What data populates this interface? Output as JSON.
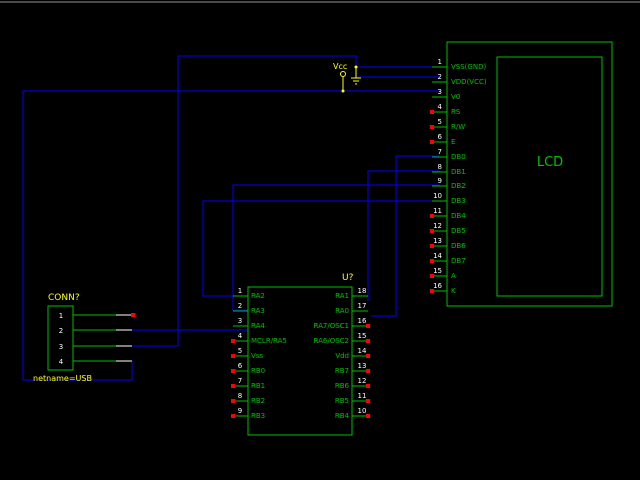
{
  "colors": {
    "background": "#000000",
    "wire": "#0000ff",
    "component": "#00c000",
    "pin_text": "#ffffff",
    "label_text": "#ffff00",
    "pin_end": "#ff0000"
  },
  "lcd": {
    "title": "LCD",
    "pins": [
      {
        "num": "1",
        "name": "VSS(GND)"
      },
      {
        "num": "2",
        "name": "VDD(VCC)"
      },
      {
        "num": "3",
        "name": "V0"
      },
      {
        "num": "4",
        "name": "RS"
      },
      {
        "num": "5",
        "name": "R/W"
      },
      {
        "num": "6",
        "name": "E"
      },
      {
        "num": "7",
        "name": "DB0"
      },
      {
        "num": "8",
        "name": "DB1"
      },
      {
        "num": "9",
        "name": "DB2"
      },
      {
        "num": "10",
        "name": "DB3"
      },
      {
        "num": "11",
        "name": "DB4"
      },
      {
        "num": "12",
        "name": "DB5"
      },
      {
        "num": "13",
        "name": "DB6"
      },
      {
        "num": "14",
        "name": "DB7"
      },
      {
        "num": "15",
        "name": "A"
      },
      {
        "num": "16",
        "name": "K"
      }
    ]
  },
  "mcu": {
    "ref": "U?",
    "left_pins": [
      {
        "num": "1",
        "name": "RA2"
      },
      {
        "num": "2",
        "name": "RA3"
      },
      {
        "num": "3",
        "name": "RA4"
      },
      {
        "num": "4",
        "name": "MCLR/RA5"
      },
      {
        "num": "5",
        "name": "Vss"
      },
      {
        "num": "6",
        "name": "RB0"
      },
      {
        "num": "7",
        "name": "RB1"
      },
      {
        "num": "8",
        "name": "RB2"
      },
      {
        "num": "9",
        "name": "RB3"
      }
    ],
    "right_pins": [
      {
        "num": "18",
        "name": "RA1"
      },
      {
        "num": "17",
        "name": "RA0"
      },
      {
        "num": "16",
        "name": "RA7/OSC1"
      },
      {
        "num": "15",
        "name": "RA6/OSC2"
      },
      {
        "num": "14",
        "name": "Vdd"
      },
      {
        "num": "13",
        "name": "RB7"
      },
      {
        "num": "12",
        "name": "RB6"
      },
      {
        "num": "11",
        "name": "RB5"
      },
      {
        "num": "10",
        "name": "RB4"
      }
    ]
  },
  "connector": {
    "ref": "CONN?",
    "pins": [
      "1",
      "2",
      "3",
      "4"
    ],
    "netname": "netname=USB"
  },
  "power": {
    "vcc_label": "Vcc"
  }
}
